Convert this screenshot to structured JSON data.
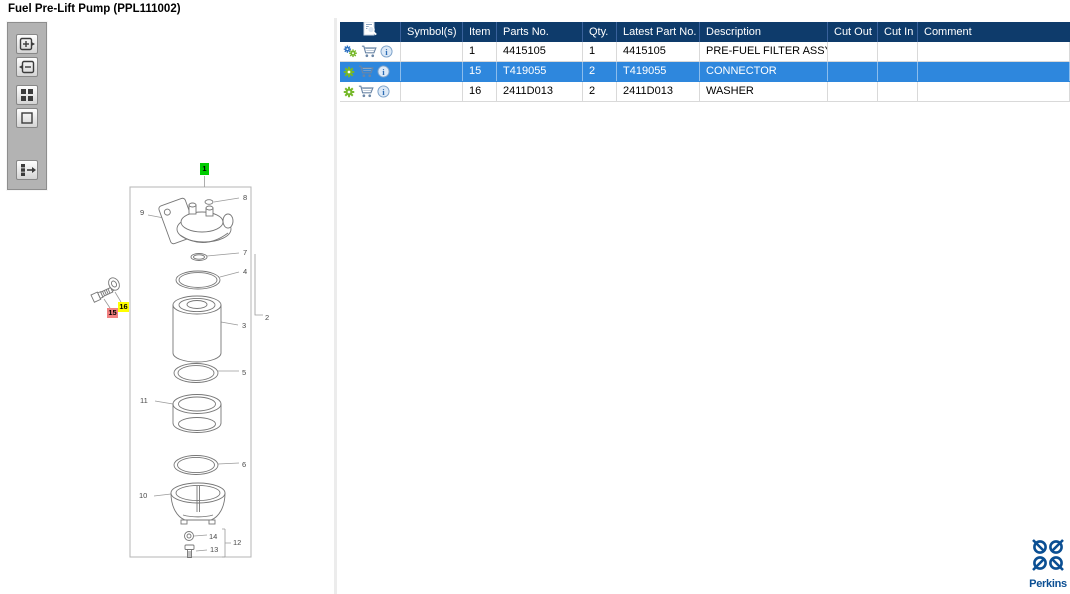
{
  "window": {
    "title": "Fuel Pre-Lift Pump (PPL111002)"
  },
  "toolbar": {
    "buttons": [
      {
        "name": "zoom-in"
      },
      {
        "name": "zoom-out"
      },
      {
        "name": "fit-view"
      },
      {
        "name": "actual-size"
      },
      {
        "name": "toggle-parts-panel"
      }
    ]
  },
  "diagram": {
    "callouts": {
      "c1": {
        "label": "1",
        "highlight": "green"
      },
      "c2": {
        "label": "2"
      },
      "c3": {
        "label": "3"
      },
      "c4": {
        "label": "4"
      },
      "c5": {
        "label": "5"
      },
      "c6": {
        "label": "6"
      },
      "c7": {
        "label": "7"
      },
      "c8": {
        "label": "8"
      },
      "c9": {
        "label": "9"
      },
      "c10": {
        "label": "10"
      },
      "c11": {
        "label": "11"
      },
      "c12": {
        "label": "12"
      },
      "c13": {
        "label": "13"
      },
      "c14": {
        "label": "14"
      },
      "c15": {
        "label": "15",
        "highlight": "red"
      },
      "c16": {
        "label": "16",
        "highlight": "yellow"
      }
    }
  },
  "table": {
    "columns": [
      "",
      "Symbol(s)",
      "Item",
      "Parts No.",
      "Qty.",
      "Latest Part No.",
      "Description",
      "Cut Out",
      "Cut In",
      "Comment"
    ],
    "rows": [
      {
        "icons": [
          "gear-add",
          "cart",
          "info"
        ],
        "symbols": "",
        "item": "1",
        "parts_no": "4415105",
        "qty": "1",
        "latest_part_no": "4415105",
        "description": "PRE-FUEL FILTER ASSY",
        "cut_out": "",
        "cut_in": "",
        "comment": "",
        "selected": false
      },
      {
        "icons": [
          "gear",
          "cart",
          "info"
        ],
        "symbols": "",
        "item": "15",
        "parts_no": "T419055",
        "qty": "2",
        "latest_part_no": "T419055",
        "description": "CONNECTOR",
        "cut_out": "",
        "cut_in": "",
        "comment": "",
        "selected": true
      },
      {
        "icons": [
          "gear",
          "cart",
          "info"
        ],
        "symbols": "",
        "item": "16",
        "parts_no": "2411D013",
        "qty": "2",
        "latest_part_no": "2411D013",
        "description": "WASHER",
        "cut_out": "",
        "cut_in": "",
        "comment": "",
        "selected": false
      }
    ]
  },
  "logo": {
    "brand": "Perkins"
  },
  "colors": {
    "header_bg": "#0e3b6b",
    "selected_row": "#2e87dd",
    "grid_line": "#d9d9d9",
    "brand_blue": "#0b4f93",
    "highlight_green": "#00cc00",
    "highlight_yellow": "#ffff00",
    "highlight_red": "#f28080",
    "gear_green": "#76b82a",
    "gear_blue": "#2a6fc0"
  }
}
